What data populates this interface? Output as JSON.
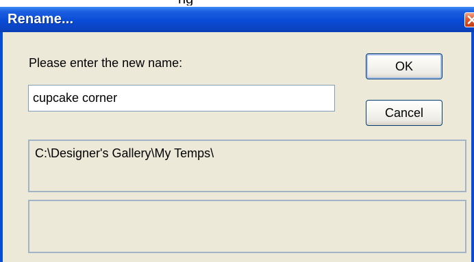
{
  "background_fragment": "ng",
  "window": {
    "title": "Rename...",
    "close_icon": "close-icon"
  },
  "prompt": {
    "label": "Please enter the new name:"
  },
  "name_field": {
    "value": "cupcake corner"
  },
  "buttons": {
    "ok_label": "OK",
    "cancel_label": "Cancel"
  },
  "path": {
    "text": "C:\\Designer's Gallery\\My Temps\\"
  },
  "colors": {
    "titlebar": "#0a4bd6",
    "dialog_bg": "#ece9d8",
    "close_button": "#e0582d"
  }
}
